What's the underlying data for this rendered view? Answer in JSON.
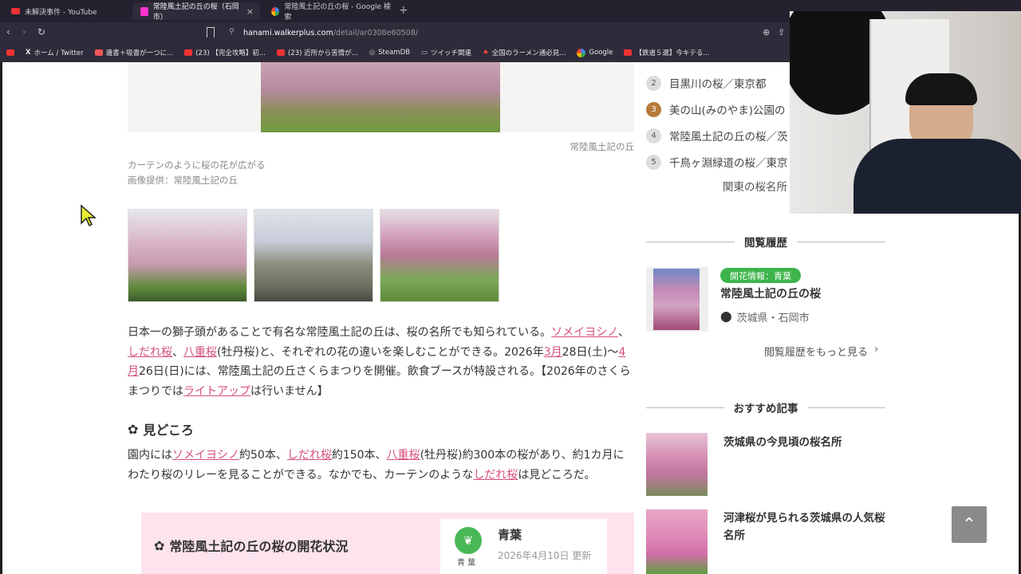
{
  "browser": {
    "tabs": [
      {
        "title": "未解決事件 - YouTube",
        "icon": "youtube-icon"
      },
      {
        "title": "常陸風土記の丘の桜（石岡市）",
        "icon": "walkerplus-icon"
      },
      {
        "title": "常陸風土記の丘の桜 - Google 検索",
        "icon": "google-icon"
      }
    ],
    "url_host": "hanami.walkerplus.com",
    "url_path": "/detail/ar0308e60508/",
    "bookmarks": [
      "ホーム / Twitter",
      "遺書＋吸書が一つに...",
      "(23) 【完全攻略】初...",
      "(23) 近所から苦情が...",
      "SteamDB",
      "ツイッチ関連",
      "全国のラーメン通必見...",
      "Google",
      "【鉄道５選】今キテる..."
    ]
  },
  "main": {
    "photo_credit_right": "常陸風土記の丘",
    "caption": "カーテンのように桜の花が広がる",
    "image_credit": "画像提供：常陸風土記の丘",
    "intro": {
      "p1": "日本一の獅子頭があることで有名な常陸風土記の丘は、桜の名所でも知られている。",
      "l1": "ソメイヨシノ",
      "p2": "、",
      "l2": "しだれ桜",
      "p3": "、",
      "l3": "八重桜",
      "p4": "(牡丹桜)と、それぞれの花の違いを楽しむことができる。2026年",
      "l4": "3月",
      "p5": "28日(土)〜",
      "l5": "4月",
      "p6": "26日(日)には、常陸風土記の丘さくらまつりを開催。飲食ブースが特設される。【2026年のさくらまつりでは",
      "l6": "ライトアップ",
      "p7": "は行いません】"
    },
    "highlights_heading": "見どころ",
    "highlights": {
      "p1": "園内には",
      "l1": "ソメイヨシノ",
      "p2": "約50本、",
      "l2": "しだれ桜",
      "p3": "約150本、",
      "l3": "八重桜",
      "p4": "(牡丹桜)約300本の桜があり、約1カ月にわたり桜のリレーを見ることができる。なかでも、カーテンのような",
      "l4": "しだれ桜",
      "p5": "は見どころだ。"
    },
    "bloom_box": {
      "title": "常陸風土記の丘の桜の開花状況",
      "status": "青葉",
      "status_icon_label": "青 葉",
      "updated": "2026年4月10日 更新"
    }
  },
  "sidebar": {
    "ranking": [
      {
        "rank": "2",
        "label": "目黒川の桜／東京都"
      },
      {
        "rank": "3",
        "label": "美の山(みのやま)公園の"
      },
      {
        "rank": "4",
        "label": "常陸風土記の丘の桜／茨"
      },
      {
        "rank": "5",
        "label": "千鳥ヶ淵緑道の桜／東京"
      }
    ],
    "ranking_more": "関東の桜名所",
    "history_title": "閲覧履歴",
    "history_item": {
      "badge": "開花情報：青葉",
      "name": "常陸風土記の丘の桜",
      "location": "茨城県・石岡市"
    },
    "history_more": "閲覧履歴をもっと見る",
    "recommended_title": "おすすめ記事",
    "recommended": [
      {
        "title": "茨城県の今見頃の桜名所"
      },
      {
        "title": "河津桜が見られる茨城県の人気桜名所"
      }
    ]
  },
  "colors": {
    "link": "#d64f7e",
    "badge_green": "#3cb44b",
    "browser_bg": "#2f2b3a"
  }
}
